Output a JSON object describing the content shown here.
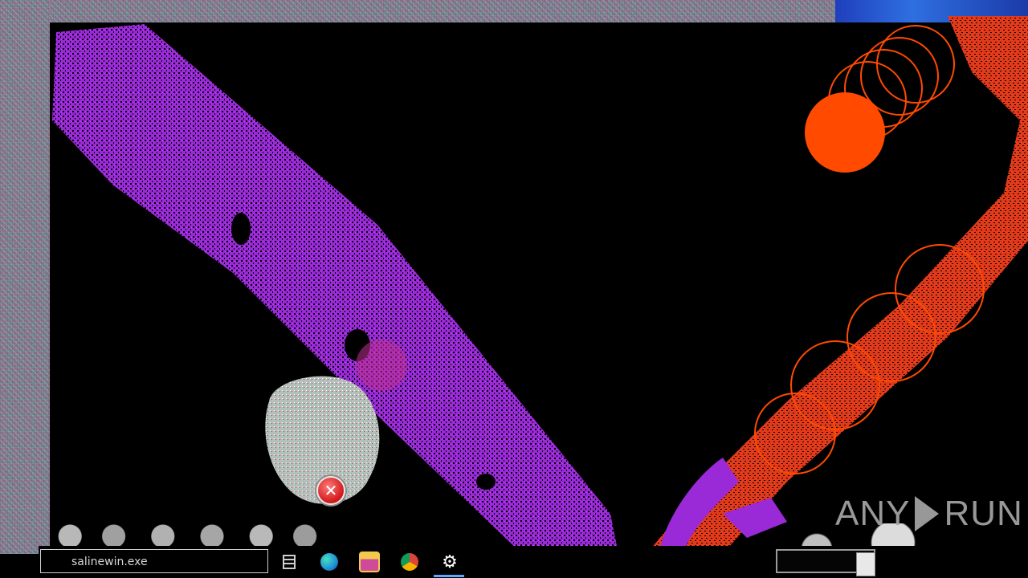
{
  "taskbar": {
    "search_value": "salinewin.exe",
    "items": [
      {
        "name": "task-view-icon",
        "color": "#cccccc"
      },
      {
        "name": "edge-icon",
        "color": "#1f8fd6"
      },
      {
        "name": "file-explorer-icon",
        "color": "#e8b21a"
      },
      {
        "name": "chrome-icon",
        "color": "#2ea44f"
      },
      {
        "name": "settings-icon",
        "color": "#ffffff"
      }
    ]
  },
  "error": {
    "icon": "error-x-icon",
    "glyph": "✕"
  },
  "watermark": {
    "text_left": "ANY",
    "text_right": "RUN"
  },
  "colors": {
    "purple": "#9a2ad8",
    "orange": "#ff4a00",
    "red": "#e23a1a"
  }
}
